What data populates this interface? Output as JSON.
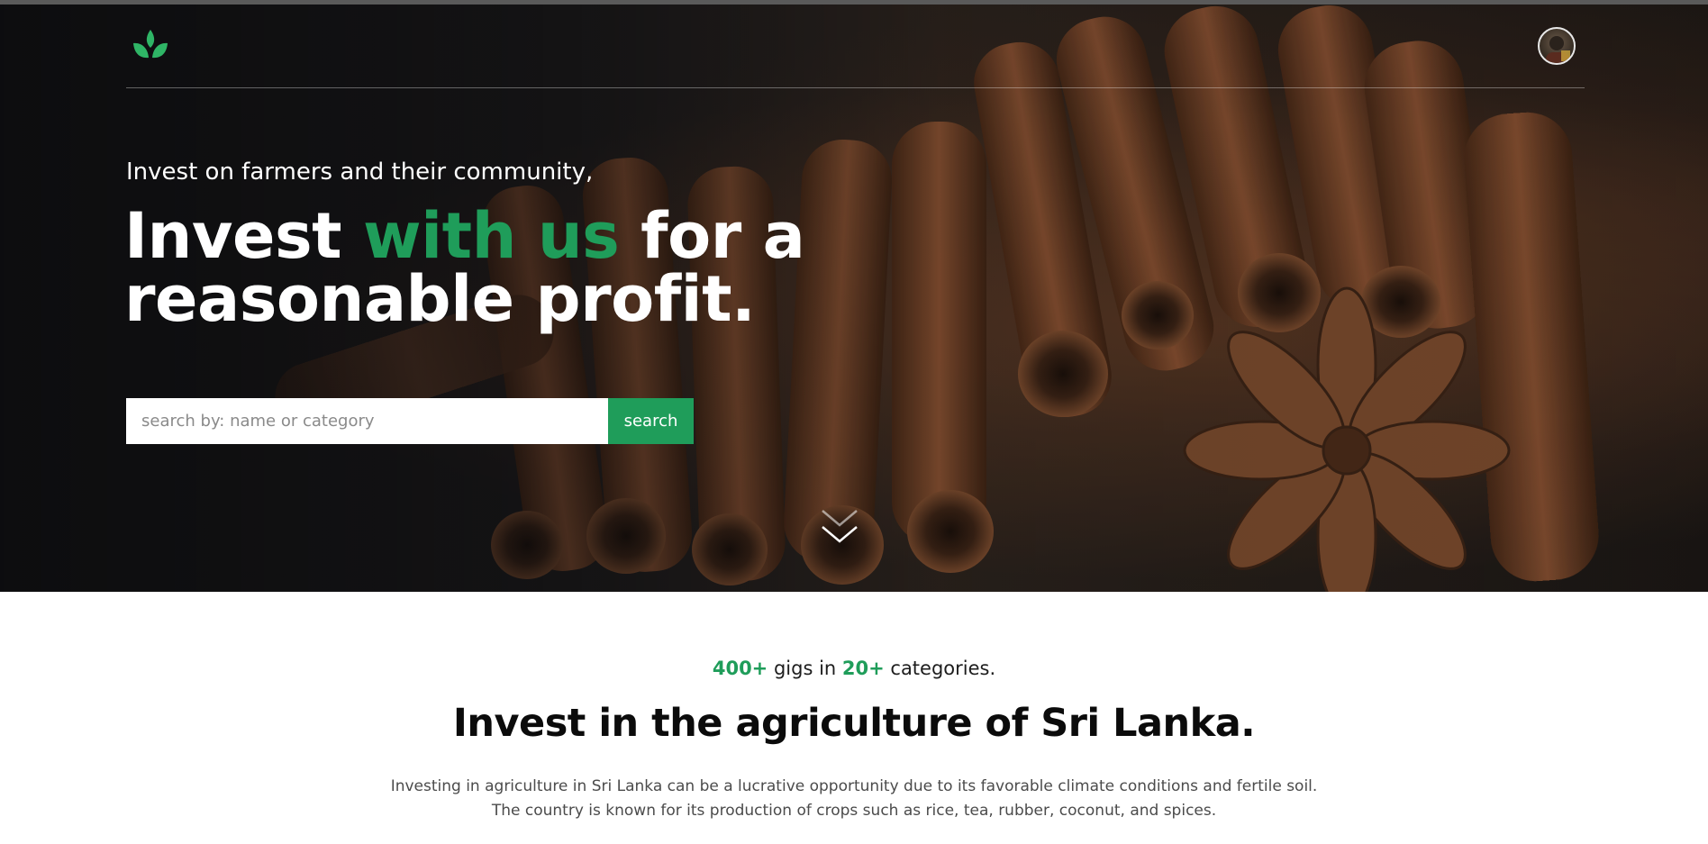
{
  "brand": {
    "logo_icon": "leaf-logo-icon",
    "accent_color": "#1f9d5a"
  },
  "nav": {
    "avatar_icon": "user-avatar"
  },
  "hero": {
    "eyebrow": "Invest on farmers and their community,",
    "headline_part1": "Invest ",
    "headline_accent": "with us",
    "headline_part2": " for a",
    "headline_line2": "reasonable profit.",
    "search": {
      "placeholder": "search by: name or category",
      "value": "",
      "button_label": "search"
    },
    "scroll_icon": "chevron-down-icon"
  },
  "stats": {
    "gigs_count": "400+",
    "gigs_text": " gigs in ",
    "categories_count": "20+",
    "categories_text": " categories."
  },
  "intro": {
    "title": "Invest in the agriculture of Sri Lanka.",
    "line1": "Investing in agriculture in Sri Lanka can be a lucrative opportunity due to its favorable climate conditions and fertile soil.",
    "line2": "The country is known for its production of crops such as rice, tea, rubber, coconut, and spices."
  }
}
